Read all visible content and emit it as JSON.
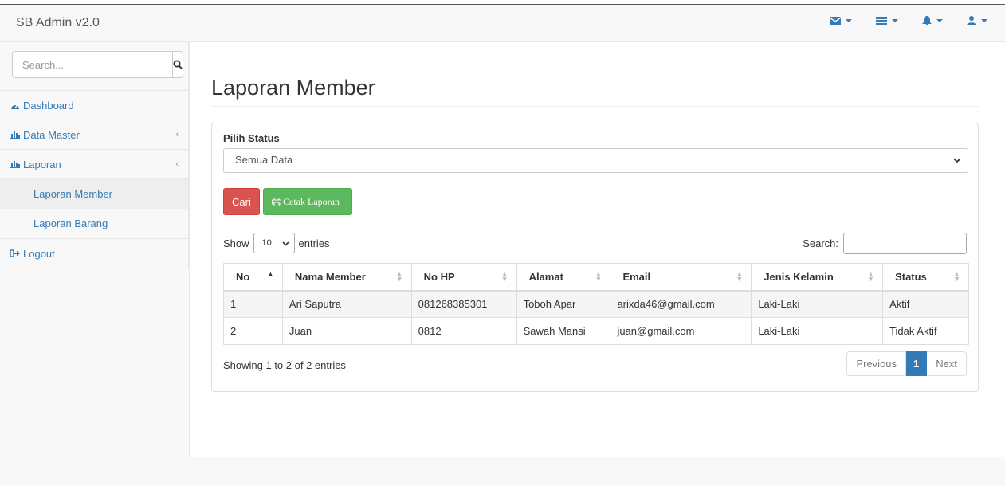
{
  "navbar": {
    "brand": "SB Admin v2.0",
    "icons": [
      "envelope-icon",
      "tasks-icon",
      "bell-icon",
      "user-icon"
    ]
  },
  "sidebar": {
    "search_placeholder": "Search...",
    "items": [
      {
        "label": "Dashboard",
        "icon": "dashboard-icon"
      },
      {
        "label": "Data Master",
        "icon": "bar-chart-icon",
        "arrow": "‹"
      },
      {
        "label": "Laporan",
        "icon": "bar-chart-icon",
        "arrow": "‹"
      },
      {
        "label": "Logout",
        "icon": "sign-out-icon"
      }
    ],
    "sub_items": [
      "Laporan Member",
      "Laporan Barang"
    ]
  },
  "main": {
    "title": "Laporan Member",
    "status_label": "Pilih Status",
    "status_selected": "Semua Data",
    "btn_cari": "Cari",
    "btn_cetak": "Cetak Laporan",
    "show_label": "Show",
    "entries_label": "entries",
    "page_length": "10",
    "search_label": "Search:",
    "columns": [
      "No",
      "Nama Member",
      "No HP",
      "Alamat",
      "Email",
      "Jenis Kelamin",
      "Status"
    ],
    "rows": [
      [
        "1",
        "Ari Saputra",
        "081268385301",
        "Toboh Apar",
        "arixda46@gmail.com",
        "Laki-Laki",
        "Aktif"
      ],
      [
        "2",
        "Juan",
        "0812",
        "Sawah Mansi",
        "juan@gmail.com",
        "Laki-Laki",
        "Tidak Aktif"
      ]
    ],
    "info": "Showing 1 to 2 of 2 entries",
    "pager": {
      "prev": "Previous",
      "current": "1",
      "next": "Next"
    }
  },
  "colors": {
    "link": "#337ab7",
    "danger": "#d9534f",
    "success": "#5cb85c"
  }
}
